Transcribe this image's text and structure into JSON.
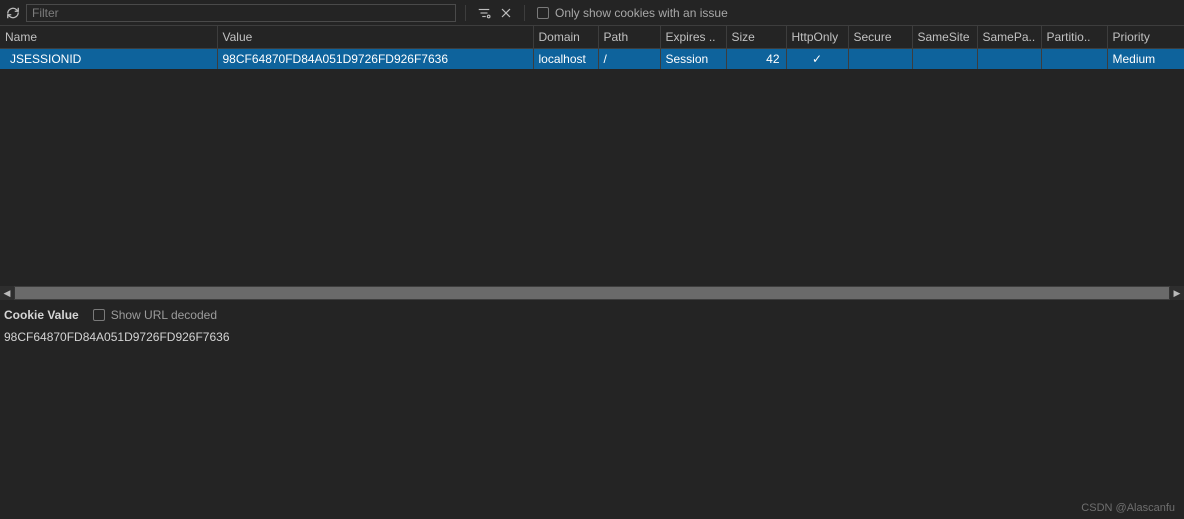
{
  "toolbar": {
    "filter_placeholder": "Filter",
    "only_issues_label": "Only show cookies with an issue"
  },
  "columns": {
    "name": "Name",
    "value": "Value",
    "domain": "Domain",
    "path": "Path",
    "expires": "Expires ..",
    "size": "Size",
    "httponly": "HttpOnly",
    "secure": "Secure",
    "samesite": "SameSite",
    "samepa": "SamePa..",
    "partition": "Partitio..",
    "priority": "Priority"
  },
  "rows": [
    {
      "name": "JSESSIONID",
      "value": "98CF64870FD84A051D9726FD926F7636",
      "domain": "localhost",
      "path": "/",
      "expires": "Session",
      "size": "42",
      "httponly": "✓",
      "secure": "",
      "samesite": "",
      "samepa": "",
      "partition": "",
      "priority": "Medium"
    }
  ],
  "details": {
    "title": "Cookie Value",
    "show_decoded_label": "Show URL decoded",
    "value": "98CF64870FD84A051D9726FD926F7636"
  },
  "watermark": "CSDN @Alascanfu"
}
